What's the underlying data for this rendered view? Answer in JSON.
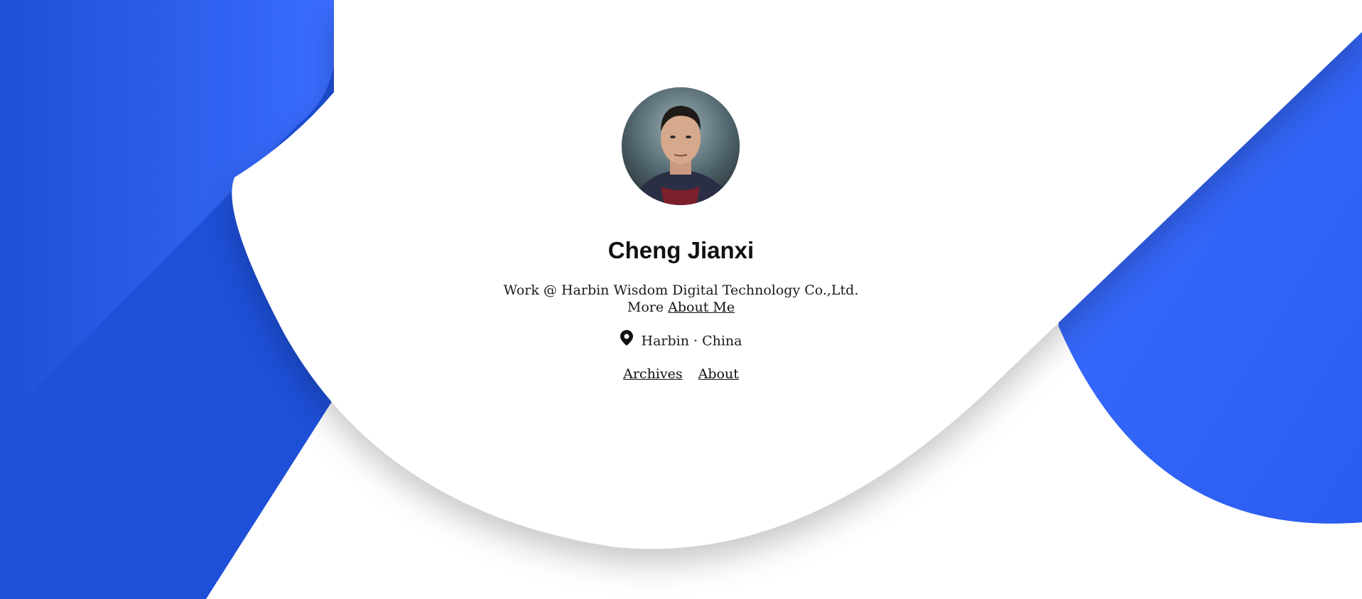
{
  "profile": {
    "name": "Cheng Jianxi",
    "bio_line1": "Work @ Harbin Wisdom Digital Technology Co.,Ltd.",
    "bio_more_prefix": "More",
    "about_me_link": "About Me",
    "location": "Harbin · China",
    "avatar_alt": "avatar"
  },
  "nav": {
    "archives": "Archives",
    "about": "About"
  },
  "icons": {
    "location": "map-pin-icon"
  },
  "colors": {
    "primary_blue": "#1f4fd8",
    "light_blue": "#3a6bff",
    "text": "#111111",
    "background": "#ffffff"
  }
}
